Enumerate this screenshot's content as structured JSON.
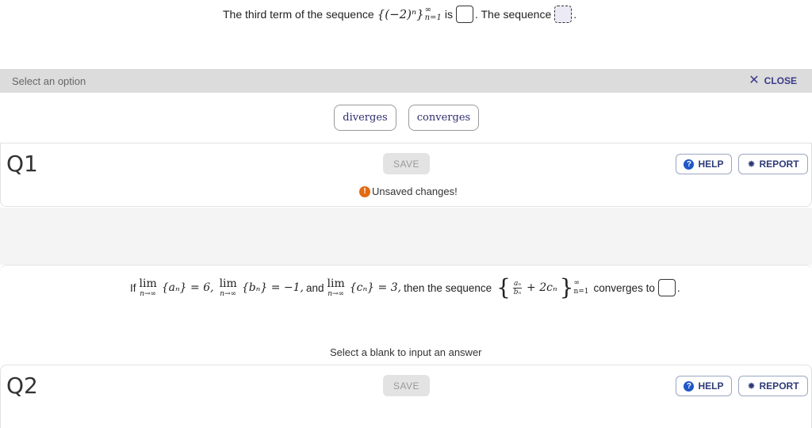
{
  "q1": {
    "prefix": "The third term of the sequence",
    "sequence_expr": "{(−2)ⁿ}",
    "seq_sup": "∞",
    "seq_sub": "n=1",
    "is_word": "is",
    "middle": ". The sequence",
    "end": "."
  },
  "option_bar": {
    "hint": "Select an option",
    "close_label": "CLOSE",
    "options": [
      "diverges",
      "converges"
    ]
  },
  "question1": {
    "label": "Q1",
    "save_label": "SAVE",
    "unsaved_text": "Unsaved changes!",
    "help_label": "HELP",
    "report_label": "REPORT"
  },
  "q2": {
    "if_word": "If",
    "lim1_expr": "{aₙ} = 6,",
    "lim2_expr": "{bₙ} = −1,",
    "and_word": "and",
    "lim3_expr": "{cₙ} = 3,",
    "then_text": "then the sequence",
    "frac_num": "aₙ",
    "frac_den": "bₙ",
    "plus_term": "+ 2cₙ",
    "limit_sup": "∞",
    "limit_sub": "n=1",
    "converges_to": "converges to",
    "end": ".",
    "lim_word": "lim",
    "lim_sub": "n→∞",
    "select_blank_hint": "Select a blank to input an answer"
  },
  "question2": {
    "label": "Q2",
    "save_label": "SAVE",
    "help_label": "HELP",
    "report_label": "REPORT"
  },
  "colors": {
    "accent": "#2e3a78",
    "warning": "#e36b12",
    "help_icon": "#1f57c7",
    "option_bar_bg": "#dcdcdc"
  }
}
